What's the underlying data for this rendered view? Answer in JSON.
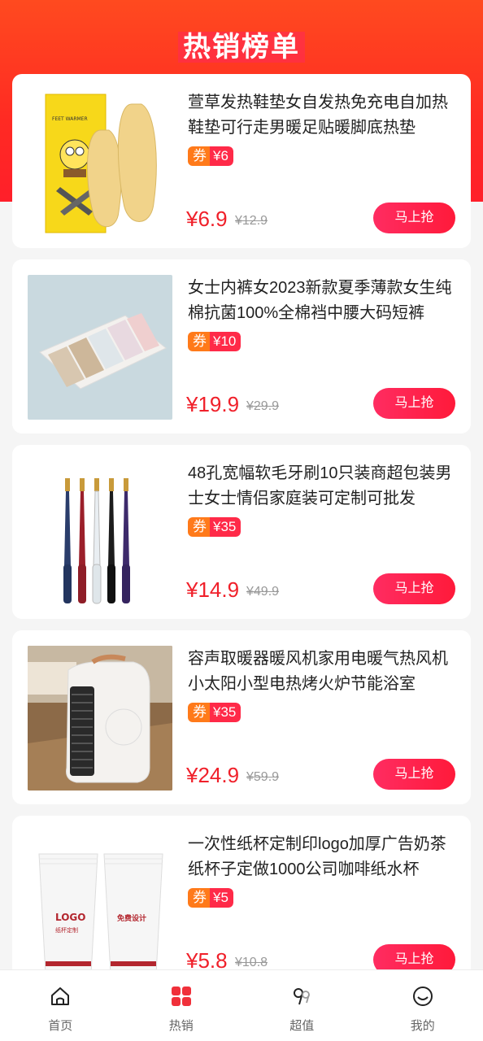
{
  "header": {
    "title": "热销榜单"
  },
  "products": [
    {
      "title": "萱草发热鞋垫女自发热免充电自加热鞋垫可行走男暖足贴暖脚底热垫",
      "coupon_tag": "券",
      "coupon_value": "¥6",
      "price": "¥6.9",
      "original_price": "¥12.9",
      "buy_label": "马上抢",
      "image_label": "FEET WARMER"
    },
    {
      "title": "女士内裤女2023新款夏季薄款女生纯棉抗菌100%全棉裆中腰大码短裤",
      "coupon_tag": "券",
      "coupon_value": "¥10",
      "price": "¥19.9",
      "original_price": "¥29.9",
      "buy_label": "马上抢"
    },
    {
      "title": "48孔宽幅软毛牙刷10只装商超包装男士女士情侣家庭装可定制可批发",
      "coupon_tag": "券",
      "coupon_value": "¥35",
      "price": "¥14.9",
      "original_price": "¥49.9",
      "buy_label": "马上抢"
    },
    {
      "title": "容声取暖器暖风机家用电暖气热风机小太阳小型电热烤火炉节能浴室",
      "coupon_tag": "券",
      "coupon_value": "¥35",
      "price": "¥24.9",
      "original_price": "¥59.9",
      "buy_label": "马上抢"
    },
    {
      "title": "一次性纸杯定制印logo加厚广告奶茶纸杯子定做1000公司咖啡纸水杯",
      "coupon_tag": "券",
      "coupon_value": "¥5",
      "price": "¥5.8",
      "original_price": "¥10.8",
      "buy_label": "马上抢",
      "image_label_1": "LOGO",
      "image_label_2": "纸杯定制",
      "image_label_3": "免费设计"
    }
  ],
  "tabbar": [
    {
      "label": "首页",
      "icon": "home-icon"
    },
    {
      "label": "热销",
      "icon": "grid-icon",
      "active": true
    },
    {
      "label": "超值",
      "icon": "ninety-nine-icon"
    },
    {
      "label": "我的",
      "icon": "smile-icon"
    }
  ],
  "colors": {
    "accent": "#ff2a48",
    "header": "#ff3a22",
    "coupon_orange": "#ff7a1a"
  }
}
